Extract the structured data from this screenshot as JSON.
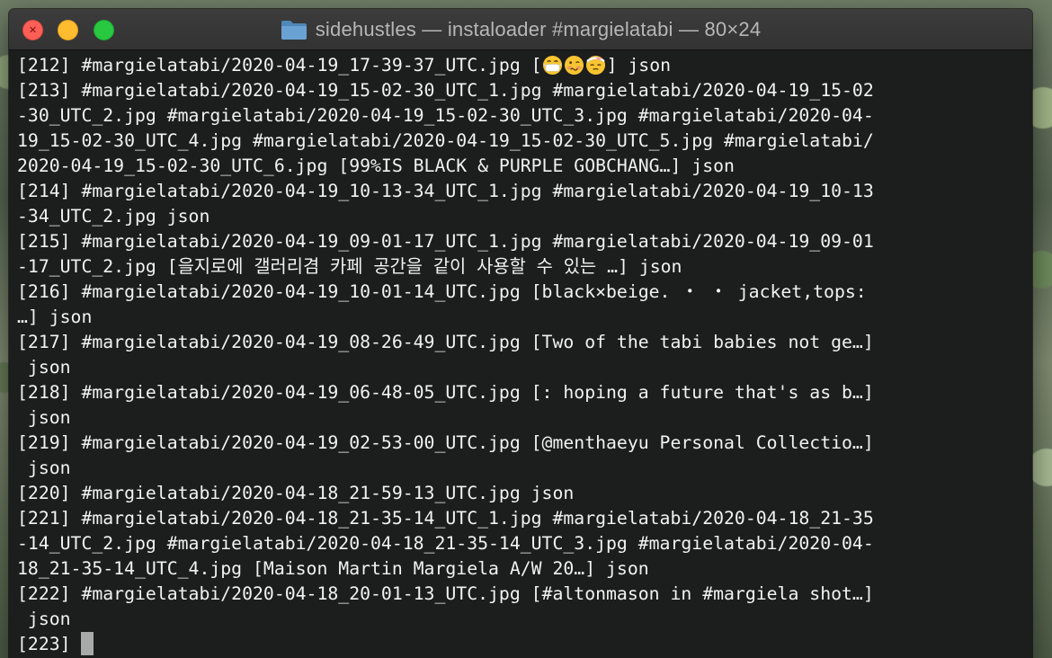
{
  "window": {
    "title": "sidehustles — instaloader #margielatabi — 80×24"
  },
  "terminal": {
    "lines": [
      "[212] #margielatabi/2020-04-19_17-39-37_UTC.jpg [",
      "[213] #margielatabi/2020-04-19_15-02-30_UTC_1.jpg #margielatabi/2020-04-19_15-02",
      "-30_UTC_2.jpg #margielatabi/2020-04-19_15-02-30_UTC_3.jpg #margielatabi/2020-04-",
      "19_15-02-30_UTC_4.jpg #margielatabi/2020-04-19_15-02-30_UTC_5.jpg #margielatabi/",
      "2020-04-19_15-02-30_UTC_6.jpg [99%IS BLACK & PURPLE GOBCHANG…] json",
      "[214] #margielatabi/2020-04-19_10-13-34_UTC_1.jpg #margielatabi/2020-04-19_10-13",
      "-34_UTC_2.jpg json",
      "[215] #margielatabi/2020-04-19_09-01-17_UTC_1.jpg #margielatabi/2020-04-19_09-01",
      "-17_UTC_2.jpg [을지로에 갤러리겸 카페 공간을 같이 사용할 수 있는 …] json",
      "[216] #margielatabi/2020-04-19_10-01-14_UTC.jpg [black×beige. ・ ・ jacket,tops:",
      "…] json",
      "[217] #margielatabi/2020-04-19_08-26-49_UTC.jpg [Two of the tabi babies not ge…]",
      " json",
      "[218] #margielatabi/2020-04-19_06-48-05_UTC.jpg [: hoping a future that's as b…]",
      " json",
      "[219] #margielatabi/2020-04-19_02-53-00_UTC.jpg [@menthaeyu Personal Collectio…]",
      " json",
      "[220] #margielatabi/2020-04-18_21-59-13_UTC.jpg json",
      "[221] #margielatabi/2020-04-18_21-35-14_UTC_1.jpg #margielatabi/2020-04-18_21-35",
      "-14_UTC_2.jpg #margielatabi/2020-04-18_21-35-14_UTC_3.jpg #margielatabi/2020-04-",
      "18_21-35-14_UTC_4.jpg [Maison Martin Margiela A/W 20…] json",
      "[222] #margielatabi/2020-04-18_20-01-13_UTC.jpg [#altonmason in #margiela shot…]",
      " json",
      "[223] "
    ],
    "first_line_suffix": "] json",
    "emojis": [
      "face-with-medical-mask-emoji",
      "woozy-face-emoji",
      "face-with-head-bandage-emoji"
    ]
  }
}
